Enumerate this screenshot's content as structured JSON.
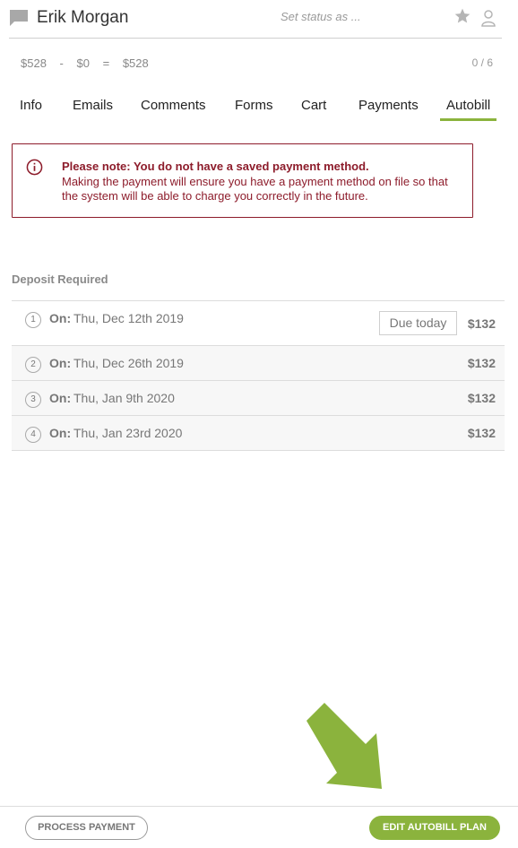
{
  "header": {
    "client_name": "Erik Morgan",
    "status_placeholder": "Set status as ...",
    "chat_icon": "chat-bubble-icon",
    "star_icon": "star-icon",
    "user_icon": "user-icon"
  },
  "totals": {
    "total": "$528",
    "minus": "-",
    "paid": "$0",
    "equals": "=",
    "balance": "$528",
    "count": "0 / 6"
  },
  "tabs": [
    {
      "label": "Info",
      "active": false
    },
    {
      "label": "Emails",
      "active": false
    },
    {
      "label": "Comments",
      "active": false
    },
    {
      "label": "Forms",
      "active": false
    },
    {
      "label": "Cart",
      "active": false
    },
    {
      "label": "Payments",
      "active": false
    },
    {
      "label": "Autobill",
      "active": true
    }
  ],
  "alert": {
    "title": "Please note: You do not have a saved payment method.",
    "body": "Making the payment will ensure you have a payment method on file so that the system will be able to charge you correctly in the future.",
    "icon": "info-circle-icon"
  },
  "deposits": {
    "title": "Deposit Required",
    "on_label": "On:",
    "due_today_label": "Due today",
    "rows": [
      {
        "num": "1",
        "date": "Thu, Dec 12th 2019",
        "amount": "$132",
        "due_today": true
      },
      {
        "num": "2",
        "date": "Thu, Dec 26th 2019",
        "amount": "$132",
        "due_today": false
      },
      {
        "num": "3",
        "date": "Thu, Jan 9th 2020",
        "amount": "$132",
        "due_today": false
      },
      {
        "num": "4",
        "date": "Thu, Jan 23rd 2020",
        "amount": "$132",
        "due_today": false
      }
    ]
  },
  "footer": {
    "process_payment_label": "PROCESS PAYMENT",
    "edit_autobill_label": "EDIT AUTOBILL PLAN"
  },
  "colors": {
    "accent": "#8bb33d",
    "alert": "#8d1c2b"
  }
}
